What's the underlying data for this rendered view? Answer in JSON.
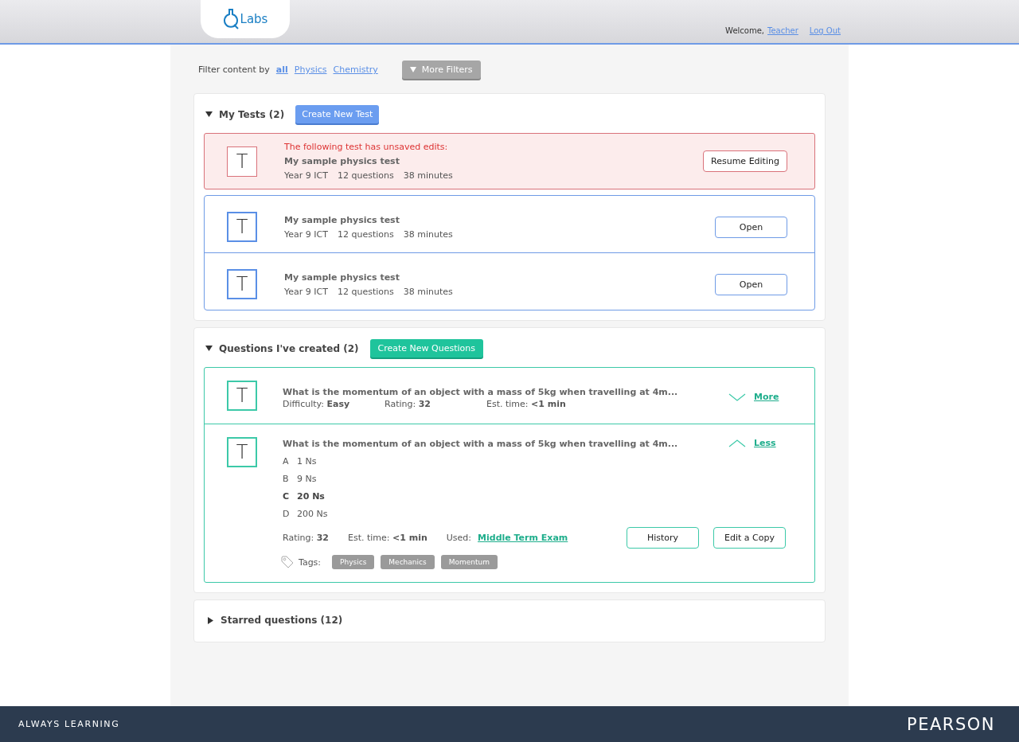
{
  "header": {
    "logo_text": "Labs",
    "welcome": "Welcome,",
    "user": "Teacher",
    "logout": "Log Out"
  },
  "filter": {
    "label": "Filter content by",
    "options": [
      {
        "label": "all",
        "selected": true
      },
      {
        "label": "Physics",
        "selected": false
      },
      {
        "label": "Chemistry",
        "selected": false
      }
    ],
    "more_filters": "More Filters"
  },
  "my_tests": {
    "title": "My Tests (2)",
    "expanded": true,
    "button": "Create New Test",
    "items": [
      {
        "kind": "unsaved",
        "icon_letter": "T",
        "notice": "The following test has unsaved edits:",
        "title": "My sample physics test",
        "meta": [
          "Year 9 ICT",
          "12 questions",
          "38 minutes"
        ],
        "action": "Resume Editing"
      },
      {
        "kind": "saved",
        "icon_letter": "T",
        "title": "My sample physics test",
        "meta": [
          "Year 9 ICT",
          "12 questions",
          "38 minutes"
        ],
        "action": "Open"
      },
      {
        "kind": "saved",
        "icon_letter": "T",
        "title": "My sample physics test",
        "meta": [
          "Year 9 ICT",
          "12 questions",
          "38 minutes"
        ],
        "action": "Open"
      }
    ]
  },
  "questions": {
    "title": "Questions I've created (2)",
    "expanded": true,
    "button": "Create New Questions",
    "items": [
      {
        "expanded": false,
        "icon_letter": "T",
        "question": "What is the momentum of an object with a mass of 5kg when travelling at 4m...",
        "meta": [
          "Difficulty: **Easy**",
          "Rating: **32**",
          "Est. time: **<1 min**"
        ],
        "toggle": "More"
      },
      {
        "expanded": true,
        "icon_letter": "T",
        "question": "What is the momentum of an object with a mass of 5kg when travelling at 4m...",
        "toggle": "Less",
        "answers": [
          {
            "letter": "A",
            "text": "1 Ns",
            "correct": false
          },
          {
            "letter": "B",
            "text": "9 Ns",
            "correct": false
          },
          {
            "letter": "C",
            "text": "20 Ns",
            "correct": true
          },
          {
            "letter": "D",
            "text": "200 Ns",
            "correct": false
          }
        ],
        "meta": [
          "Rating: **32**",
          "Est. time: **<1 min**"
        ],
        "used_label": "Used:",
        "used_link": "Middle Term Exam",
        "buttons": [
          "History",
          "Edit a Copy"
        ],
        "tags_label": "Tags:",
        "tags": [
          "Physics",
          "Mechanics",
          "Momentum"
        ]
      }
    ]
  },
  "starred": {
    "title": "Starred questions (12)",
    "expanded": false
  },
  "footer": {
    "tagline": "ALWAYS LEARNING",
    "brand": "PEARSON"
  }
}
